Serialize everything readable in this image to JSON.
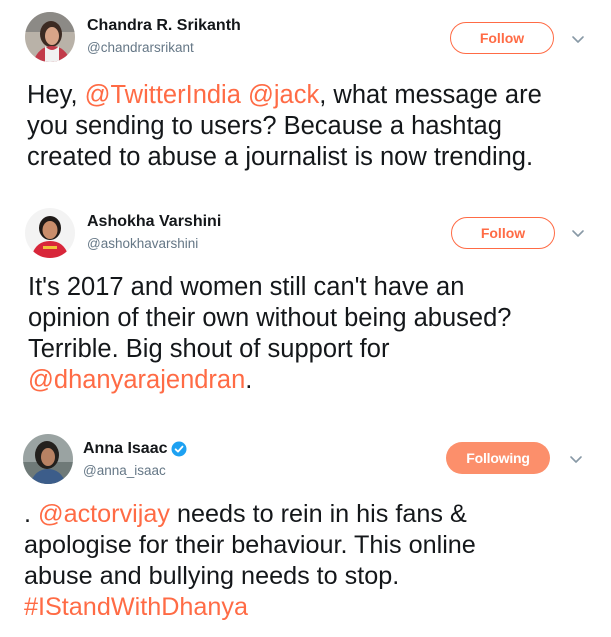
{
  "tweets": [
    {
      "display_name": "Chandra R. Srikanth",
      "handle": "@chandrarsrikant",
      "verified": false,
      "follow_label": "Follow",
      "text": {
        "l1a": "Hey, ",
        "m1": "@TwitterIndia",
        "l1b": " ",
        "m2": "@jack",
        "l1c": ",  what message are",
        "l2": "you sending to users? Because a hashtag",
        "l3": "created to abuse a journalist is now trending."
      }
    },
    {
      "display_name": "Ashokha Varshini",
      "handle": "@ashokhavarshini",
      "verified": false,
      "follow_label": "Follow",
      "text": {
        "l1": "It's 2017 and women still can't have an",
        "l2": "opinion of their own without being abused?",
        "l3": "Terrible. Big shout of support for",
        "m1": "@dhanyarajendran",
        "end": "."
      }
    },
    {
      "display_name": "Anna Isaac",
      "handle": "@anna_isaac",
      "verified": true,
      "follow_label": "Following",
      "text": {
        "l1a": ". ",
        "m1": "@actorvijay",
        "l1b": " needs to rein in his fans &",
        "l2": "apologise for their behaviour. This online",
        "l3": "abuse and bullying needs to stop.",
        "h1": "#IStandWithDhanya"
      }
    }
  ],
  "icons": {
    "chevron": "chevron-down-icon",
    "verified": "verified-badge-icon"
  },
  "colors": {
    "accent": "#ff6b45",
    "following_bg": "#fc8f6b",
    "text": "#14171a",
    "muted": "#657786",
    "verified": "#1da1f2"
  }
}
